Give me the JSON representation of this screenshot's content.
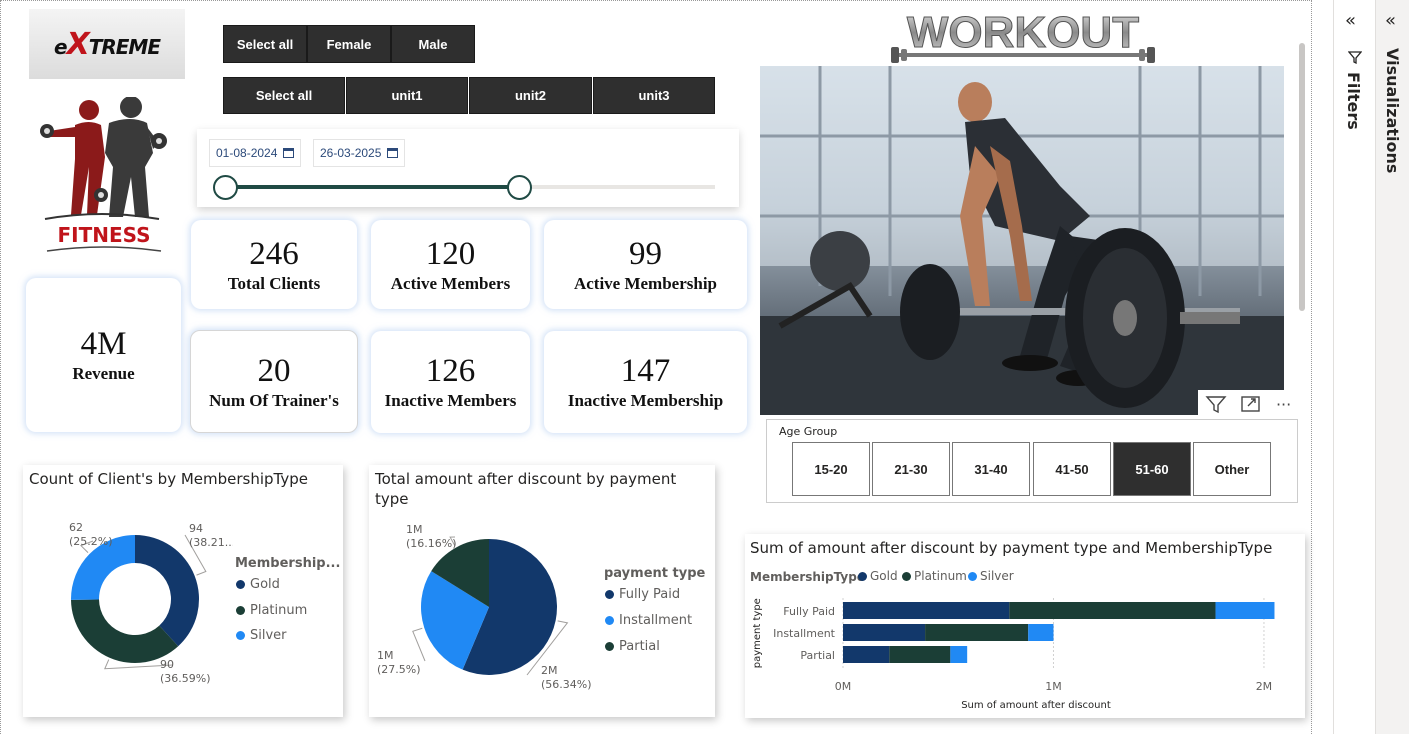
{
  "logo": {
    "brand": "EXTREME",
    "x_letter": "X",
    "fitness": "FITNESS"
  },
  "gender_slicer": [
    "Select all",
    "Female",
    "Male"
  ],
  "unit_slicer": [
    "Select all",
    "unit1",
    "unit2",
    "unit3"
  ],
  "date_slicer": {
    "start": "01-08-2024",
    "end": "26-03-2025",
    "range_fraction": [
      0.0,
      0.6
    ]
  },
  "kpis": {
    "total_clients": {
      "value": "246",
      "label": "Total Clients"
    },
    "active_members": {
      "value": "120",
      "label": "Active Members"
    },
    "active_membership": {
      "value": "99",
      "label": "Active Membership"
    },
    "revenue": {
      "value": "4M",
      "label": "Revenue"
    },
    "num_trainers": {
      "value": "20",
      "label": "Num Of Trainer's"
    },
    "inactive_members": {
      "value": "126",
      "label": "Inactive Members"
    },
    "inactive_membership": {
      "value": "147",
      "label": "Inactive Membership"
    }
  },
  "header_image": {
    "title": "WORKOUT"
  },
  "visual_toolbar": {
    "filter": "filter-icon",
    "focus": "focus-mode-icon",
    "more": "···"
  },
  "age_group": {
    "title": "Age Group",
    "options": [
      "15-20",
      "21-30",
      "31-40",
      "41-50",
      "51-60",
      "Other"
    ],
    "selected": "51-60"
  },
  "colors": {
    "gold": "#12386b",
    "platinum": "#1b3e36",
    "silver": "#2089f4",
    "fully_paid": "#12386b",
    "installment": "#2089f4",
    "partial": "#1b3e36"
  },
  "right_panes": {
    "filters": "Filters",
    "visualizations": "Visualizations"
  },
  "chart_data": [
    {
      "type": "pie",
      "variant": "donut",
      "title": "Count of Client's by MembershipType",
      "legend_title": "Membership...",
      "categories": [
        "Gold",
        "Platinum",
        "Silver"
      ],
      "values": [
        94,
        90,
        62
      ],
      "labels": [
        [
          "94",
          "(38.21...)"
        ],
        [
          "90",
          "(36.59%)"
        ],
        [
          "62",
          "(25.2%)"
        ]
      ]
    },
    {
      "type": "pie",
      "title": "Total amount after discount by payment type",
      "legend_title": "payment type",
      "categories": [
        "Fully Paid",
        "Installment",
        "Partial"
      ],
      "values": [
        56.34,
        27.5,
        16.16
      ],
      "labels": [
        [
          "2M",
          "(56.34%)"
        ],
        [
          "1M",
          "(27.5%)"
        ],
        [
          "1M",
          "(16.16%)"
        ]
      ]
    },
    {
      "type": "bar",
      "orientation": "horizontal",
      "stacked": true,
      "title": "Sum of amount after discount by payment type and MembershipType",
      "legend_title": "MembershipType",
      "categories": [
        "Fully Paid",
        "Installment",
        "Partial"
      ],
      "series": [
        {
          "name": "Gold",
          "values": [
            0.79,
            0.39,
            0.22
          ]
        },
        {
          "name": "Platinum",
          "values": [
            0.98,
            0.49,
            0.29
          ]
        },
        {
          "name": "Silver",
          "values": [
            0.28,
            0.12,
            0.08
          ]
        }
      ],
      "xlabel": "Sum of amount after discount",
      "ylabel": "payment type",
      "xticks": [
        "0M",
        "1M",
        "2M"
      ],
      "xlim": [
        0,
        2.1
      ],
      "grid": true,
      "legend_position": "top-left"
    }
  ]
}
